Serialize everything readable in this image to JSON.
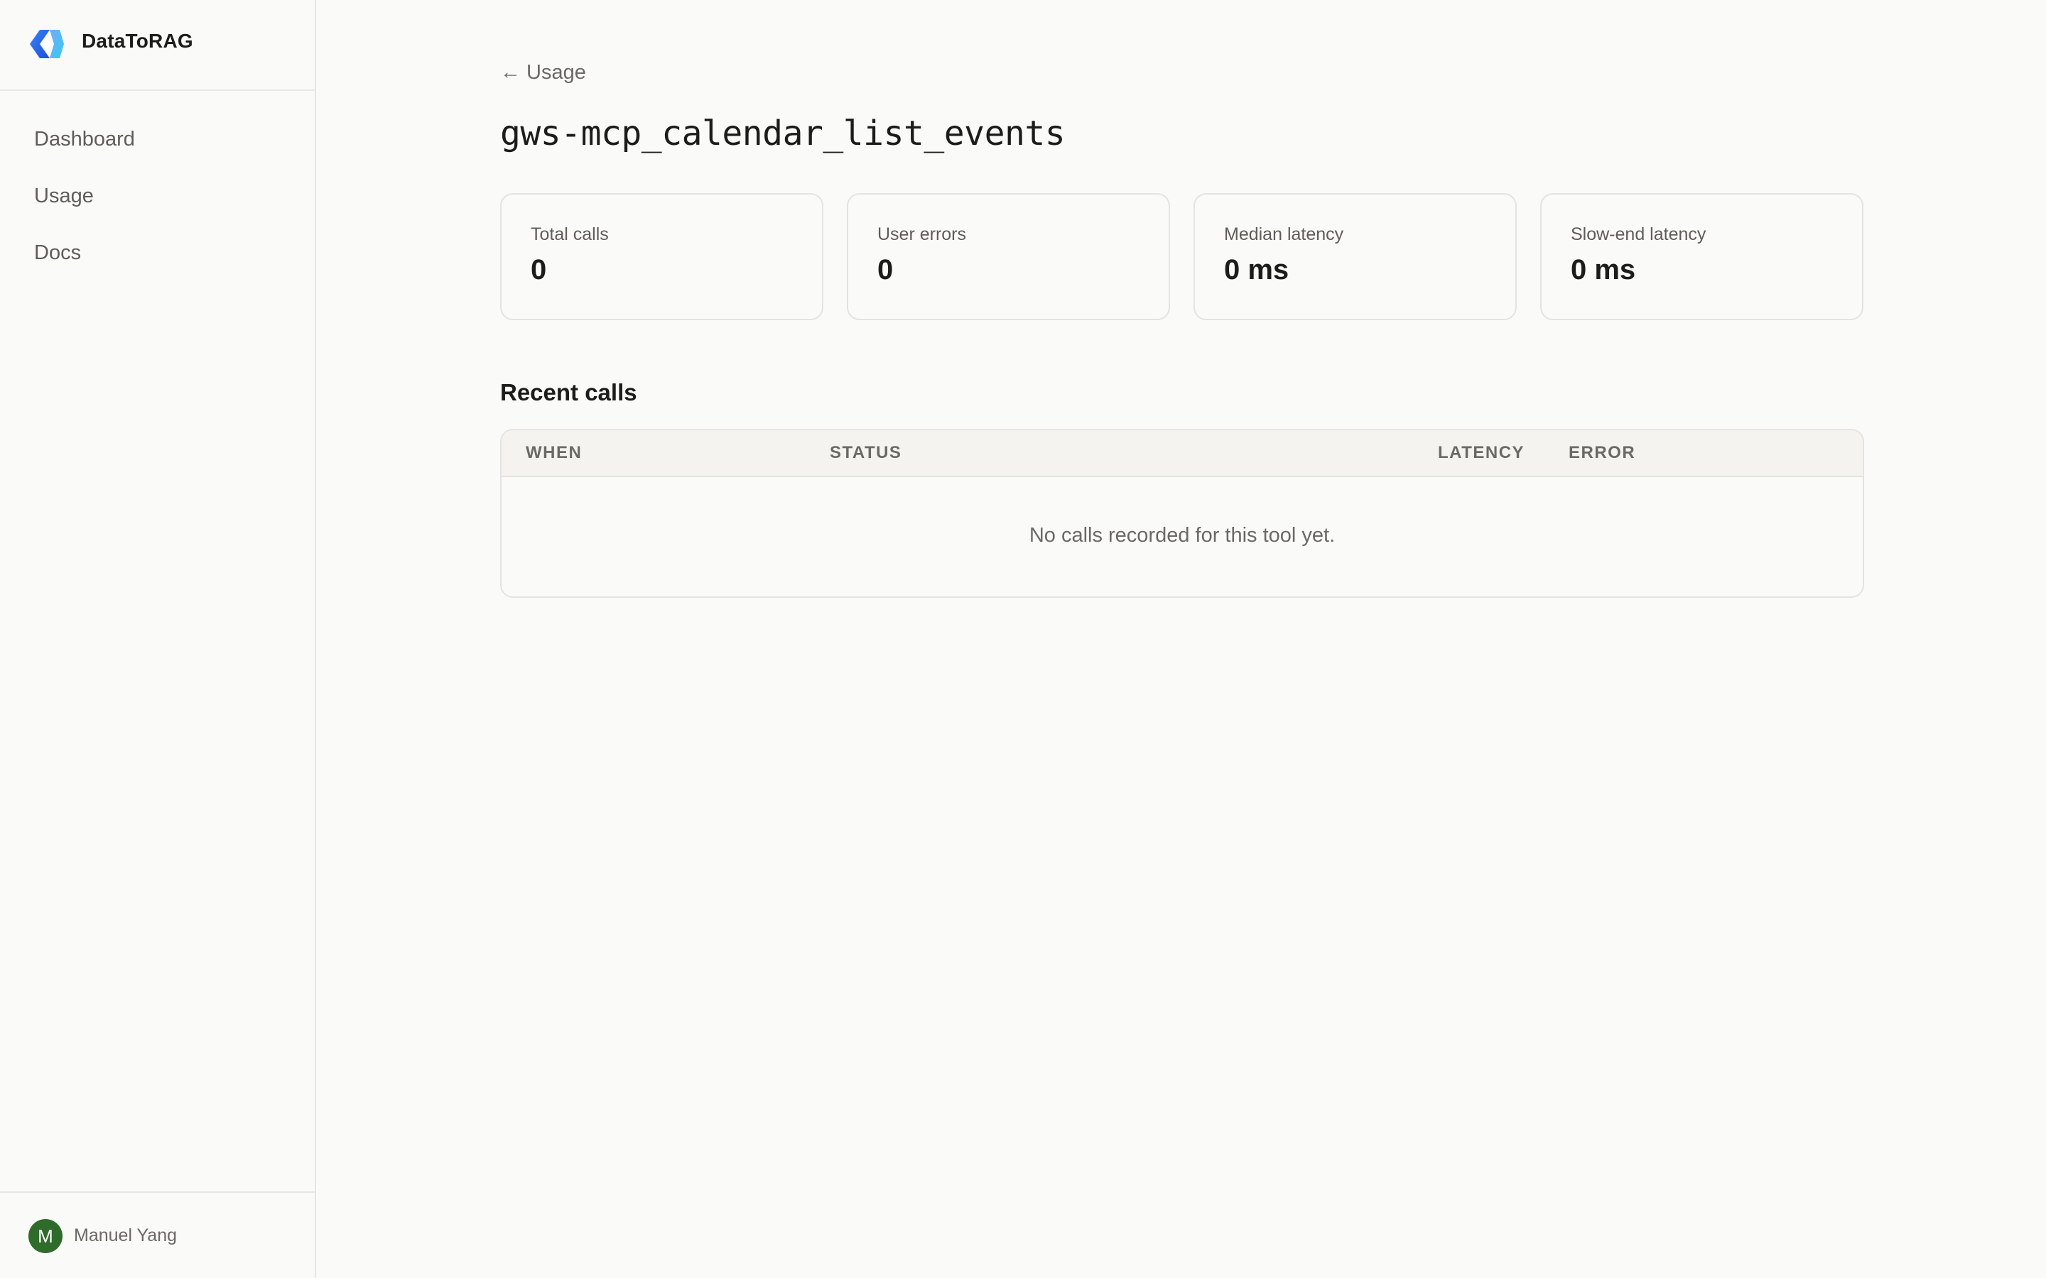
{
  "brand": {
    "name": "DataToRAG",
    "accent": "#2f7df6"
  },
  "nav": {
    "items": [
      {
        "label": "Dashboard"
      },
      {
        "label": "Usage"
      },
      {
        "label": "Docs"
      }
    ]
  },
  "user": {
    "initial": "M",
    "name": "Manuel Yang",
    "avatar_color": "#2f6b2a"
  },
  "page": {
    "back_label": "← Usage",
    "title": "gws-mcp_calendar_list_events"
  },
  "stats": [
    {
      "label": "Total calls",
      "value": "0"
    },
    {
      "label": "User errors",
      "value": "0"
    },
    {
      "label": "Median latency",
      "value": "0 ms"
    },
    {
      "label": "Slow-end latency",
      "value": "0 ms"
    }
  ],
  "recent_calls": {
    "title": "Recent calls",
    "columns": [
      "WHEN",
      "STATUS",
      "LATENCY",
      "ERROR"
    ],
    "empty_message": "No calls recorded for this tool yet."
  }
}
